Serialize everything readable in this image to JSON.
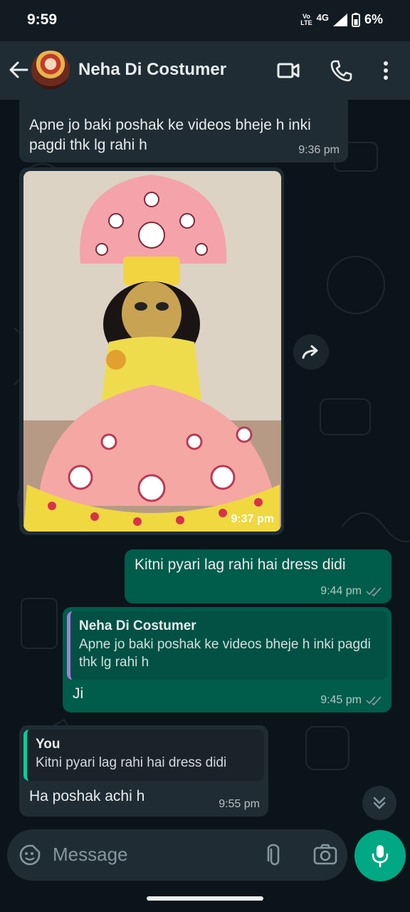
{
  "status": {
    "time": "9:59",
    "volte": "Vo\nLTE",
    "network": "4G",
    "battery": "6%"
  },
  "header": {
    "contact_name": "Neha Di Costumer",
    "icons": [
      "back-arrow-icon",
      "video-call-icon",
      "phone-call-icon",
      "more-vertical-icon"
    ]
  },
  "messages": [
    {
      "direction": "in",
      "text": "Apne jo baki poshak ke videos bheje h inki pagdi thk lg rahi h",
      "time": "9:36 pm"
    },
    {
      "direction": "in",
      "type": "image",
      "time": "9:37 pm"
    },
    {
      "direction": "out",
      "text": "Kitni pyari lag rahi hai dress didi",
      "time": "9:44 pm",
      "status": "read"
    },
    {
      "direction": "out",
      "quote_author": "Neha Di Costumer",
      "quote_text": "Apne jo baki poshak ke videos bheje h inki pagdi thk lg rahi h",
      "text": "Ji",
      "time": "9:45 pm",
      "status": "read"
    },
    {
      "direction": "in",
      "quote_author": "You",
      "quote_text": "Kitni pyari lag rahi hai dress didi",
      "text": "Ha poshak achi h",
      "time": "9:55 pm"
    }
  ],
  "composer": {
    "placeholder": "Message"
  },
  "colors": {
    "header_bg": "#1f2c34",
    "chat_bg": "#0b141a",
    "incoming_bubble": "#1f2c34",
    "outgoing_bubble": "#005c4b",
    "accent": "#00a884"
  }
}
